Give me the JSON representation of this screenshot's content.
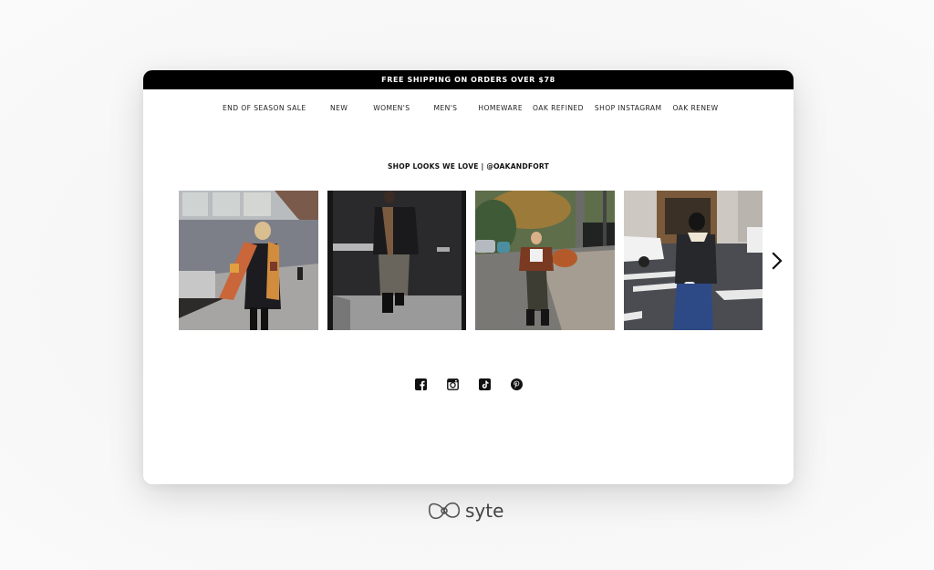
{
  "promo_banner": {
    "text": "FREE SHIPPING ON ORDERS OVER $78"
  },
  "nav": {
    "items": [
      {
        "label": "END OF SEASON SALE"
      },
      {
        "label": "NEW"
      },
      {
        "label": "WOMEN'S"
      },
      {
        "label": "MEN'S"
      },
      {
        "label": "HOMEWARE"
      },
      {
        "label": "OAK REFINED"
      },
      {
        "label": "SHOP INSTAGRAM"
      },
      {
        "label": "OAK RENEW"
      }
    ]
  },
  "section": {
    "title": "SHOP LOOKS WE LOVE | @OAKANDFORT"
  },
  "carousel": {
    "tiles": [
      {
        "alt": "Woman in puffer coat with plaid scarf"
      },
      {
        "alt": "Man in leather jacket taking elevator mirror selfie"
      },
      {
        "alt": "Woman in brown puffer jacket on street"
      },
      {
        "alt": "Woman in shearling-collar jacket with white bag at crosswalk"
      }
    ],
    "next_icon": "chevron-right-icon"
  },
  "social": {
    "icons": [
      "facebook-icon",
      "instagram-icon",
      "tiktok-icon",
      "pinterest-icon"
    ]
  },
  "brand": {
    "name": "syte"
  }
}
